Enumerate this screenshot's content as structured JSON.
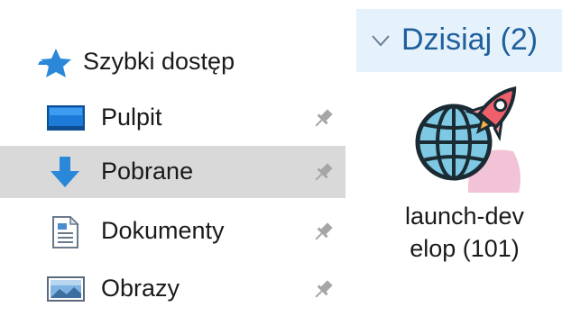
{
  "nav": {
    "quick_access": {
      "label": "Szybki dostęp",
      "icon": "star-icon"
    },
    "items": [
      {
        "label": "Pulpit",
        "icon": "desktop-icon",
        "pinned": true,
        "selected": false
      },
      {
        "label": "Pobrane",
        "icon": "download-arrow-icon",
        "pinned": true,
        "selected": true
      },
      {
        "label": "Dokumenty",
        "icon": "document-icon",
        "pinned": true,
        "selected": false
      },
      {
        "label": "Obrazy",
        "icon": "pictures-icon",
        "pinned": true,
        "selected": false
      }
    ]
  },
  "content": {
    "group": {
      "title": "Dzisiaj (2)",
      "expanded": true
    },
    "files": [
      {
        "name": "launch-develop (101)",
        "name_line1": "launch-dev",
        "name_line2": "elop (101)",
        "icon": "globe-rocket-icon"
      }
    ]
  },
  "colors": {
    "selected_bg": "#d9d9d9",
    "group_header_bg": "#e5f1fb",
    "group_title": "#1e5f9c",
    "accent_blue": "#2b88d8"
  }
}
